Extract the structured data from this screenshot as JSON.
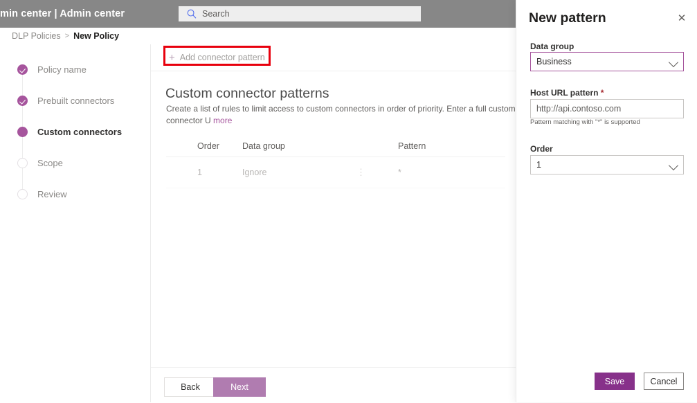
{
  "header": {
    "app_title": "min center  |  Admin center",
    "search": {
      "placeholder": "Search",
      "value": "",
      "icon": "search-icon"
    }
  },
  "breadcrumb": {
    "parent": "DLP Policies",
    "separator": ">",
    "current": "New Policy"
  },
  "wizard": {
    "steps": [
      {
        "label": "Policy name",
        "state": "done"
      },
      {
        "label": "Prebuilt connectors",
        "state": "done"
      },
      {
        "label": "Custom connectors",
        "state": "current"
      },
      {
        "label": "Scope",
        "state": "todo"
      },
      {
        "label": "Review",
        "state": "todo"
      }
    ]
  },
  "command_bar": {
    "add_pattern_label": "Add connector pattern",
    "add_pattern_icon": "plus-icon",
    "highlight_color": "#e8000d"
  },
  "main": {
    "title": "Custom connector patterns",
    "description": "Create a list of rules to limit access to custom connectors in order of priority. Enter a full custom connector U",
    "description_more": "more",
    "table": {
      "columns": [
        "Order",
        "Data group",
        "Pattern"
      ],
      "rows": [
        {
          "order": "1",
          "data_group": "Ignore",
          "menu_icon": "more-vertical-icon",
          "pattern": "*"
        }
      ]
    },
    "footer": {
      "back_label": "Back",
      "next_label": "Next"
    }
  },
  "panel": {
    "title": "New pattern",
    "close_icon": "close-icon",
    "data_group": {
      "label": "Data group",
      "value": "Business",
      "chevron_icon": "chevron-down-icon"
    },
    "host_url": {
      "label": "Host URL pattern",
      "required_marker": "*",
      "placeholder": "http://api.contoso.com",
      "value": "",
      "hint": "Pattern matching with \"*\" is supported"
    },
    "order": {
      "label": "Order",
      "value": "1",
      "chevron_icon": "chevron-down-icon"
    },
    "buttons": {
      "save_label": "Save",
      "cancel_label": "Cancel"
    }
  },
  "colors": {
    "accent_purple": "#a6559d",
    "save_purple": "#87318a",
    "next_purple": "#b07cb0",
    "header_gray": "#878787",
    "highlight_red": "#e8000d"
  }
}
